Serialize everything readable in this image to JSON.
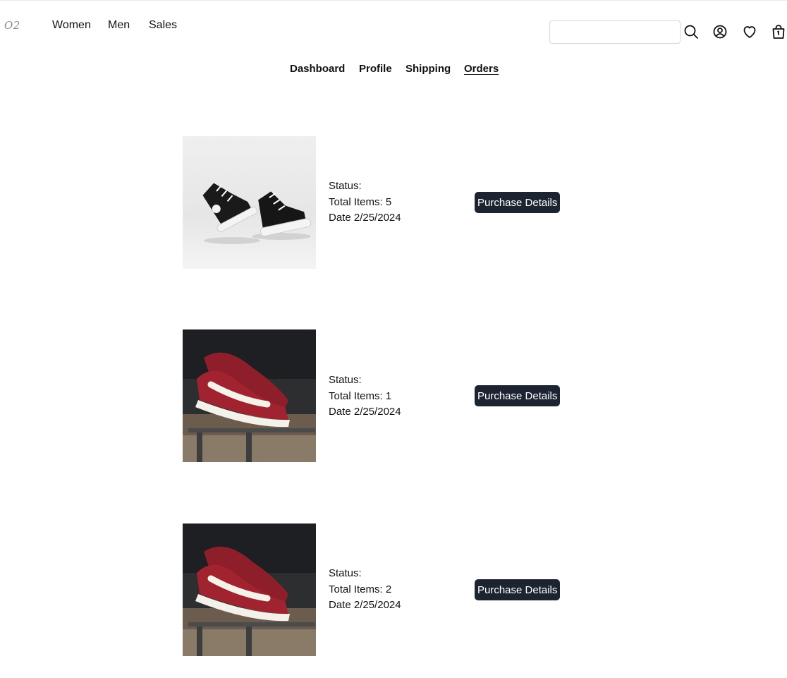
{
  "header": {
    "logo": "O2",
    "nav": [
      {
        "label": "Women"
      },
      {
        "label": "Men"
      },
      {
        "label": "Sales"
      }
    ],
    "search": {
      "placeholder": "",
      "value": ""
    },
    "icons": [
      "search-icon",
      "user-icon",
      "heart-icon",
      "shopping-bag-icon"
    ]
  },
  "account_tabs": [
    {
      "label": "Dashboard",
      "active": false
    },
    {
      "label": "Profile",
      "active": false
    },
    {
      "label": "Shipping",
      "active": false
    },
    {
      "label": "Orders",
      "active": true
    }
  ],
  "orders": [
    {
      "image": "black high-top sneakers",
      "status_label": "Status:",
      "status_value": "",
      "items_label": "Total Items:",
      "items_value": 5,
      "date_label": "Date",
      "date_value": "2/25/2024",
      "button_label": "Purchase Details"
    },
    {
      "image": "red suede sneakers",
      "status_label": "Status:",
      "status_value": "",
      "items_label": "Total Items:",
      "items_value": 1,
      "date_label": "Date",
      "date_value": "2/25/2024",
      "button_label": "Purchase Details"
    },
    {
      "image": "red suede sneakers",
      "status_label": "Status:",
      "status_value": "",
      "items_label": "Total Items:",
      "items_value": 2,
      "date_label": "Date",
      "date_value": "2/25/2024",
      "button_label": "Purchase Details"
    }
  ],
  "colors": {
    "button_bg": "#1c2431",
    "button_text": "#ffffff",
    "text": "#111111"
  }
}
